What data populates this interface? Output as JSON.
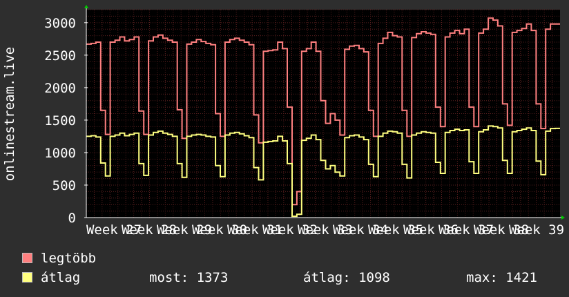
{
  "chart_data": {
    "type": "line",
    "ylabel": "onlinestream.live",
    "ylim": [
      0,
      3200
    ],
    "yticks": [
      0,
      500,
      1000,
      1500,
      2000,
      2500,
      3000
    ],
    "xlabels": [
      "Week 27",
      "Week 28",
      "Week 29",
      "Week 30",
      "Week 31",
      "Week 32",
      "Week 33",
      "Week 34",
      "Week 35",
      "Week 36",
      "Week 37",
      "Week 38",
      "Week 39"
    ],
    "grid": true,
    "colors": {
      "background": "#000000",
      "grid": "#5a1f1f",
      "axis": "#ffffff",
      "arrow": "#00cc00"
    },
    "series": [
      {
        "name": "legtöbb",
        "color": "#ff8080",
        "values": [
          2670,
          2680,
          2700,
          1650,
          1280,
          2700,
          2730,
          2780,
          2720,
          2740,
          2780,
          1640,
          1280,
          2720,
          2780,
          2810,
          2760,
          2730,
          2700,
          1660,
          1220,
          2670,
          2700,
          2740,
          2710,
          2680,
          2660,
          1600,
          1250,
          2700,
          2740,
          2760,
          2730,
          2700,
          2660,
          1580,
          1150,
          2560,
          2570,
          2580,
          2700,
          2600,
          1700,
          200,
          400,
          2560,
          2600,
          2700,
          2560,
          1800,
          1450,
          1600,
          1500,
          1270,
          2590,
          2640,
          2650,
          2600,
          2550,
          1650,
          1250,
          2680,
          2760,
          2850,
          2800,
          2780,
          1650,
          1250,
          2770,
          2830,
          2860,
          2840,
          2820,
          1700,
          1400,
          2780,
          2840,
          2880,
          2830,
          2900,
          1700,
          1400,
          2840,
          2900,
          3070,
          3040,
          2950,
          1750,
          1420,
          2850,
          2880,
          2910,
          2980,
          2880,
          1750,
          1370,
          2900,
          2980,
          2980
        ]
      },
      {
        "name": "átlag",
        "color": "#ffff80",
        "values": [
          1250,
          1260,
          1240,
          840,
          640,
          1250,
          1270,
          1300,
          1260,
          1280,
          1300,
          830,
          650,
          1270,
          1310,
          1330,
          1300,
          1280,
          1250,
          830,
          620,
          1250,
          1270,
          1280,
          1270,
          1250,
          1240,
          800,
          630,
          1270,
          1300,
          1310,
          1290,
          1260,
          1230,
          770,
          580,
          1160,
          1170,
          1180,
          1250,
          1180,
          830,
          20,
          50,
          1190,
          1220,
          1270,
          1200,
          880,
          750,
          800,
          700,
          640,
          1230,
          1260,
          1270,
          1240,
          1200,
          820,
          630,
          1250,
          1300,
          1330,
          1320,
          1300,
          820,
          610,
          1270,
          1300,
          1320,
          1310,
          1300,
          850,
          680,
          1310,
          1340,
          1360,
          1340,
          1350,
          860,
          680,
          1320,
          1350,
          1410,
          1400,
          1380,
          880,
          680,
          1320,
          1340,
          1360,
          1380,
          1340,
          870,
          660,
          1330,
          1370,
          1373
        ]
      }
    ]
  },
  "legend": {
    "max_label": "legtöbb",
    "avg_label": "átlag",
    "now": "most: 1373",
    "avg": "átlag: 1098",
    "max": "max: 1421"
  }
}
